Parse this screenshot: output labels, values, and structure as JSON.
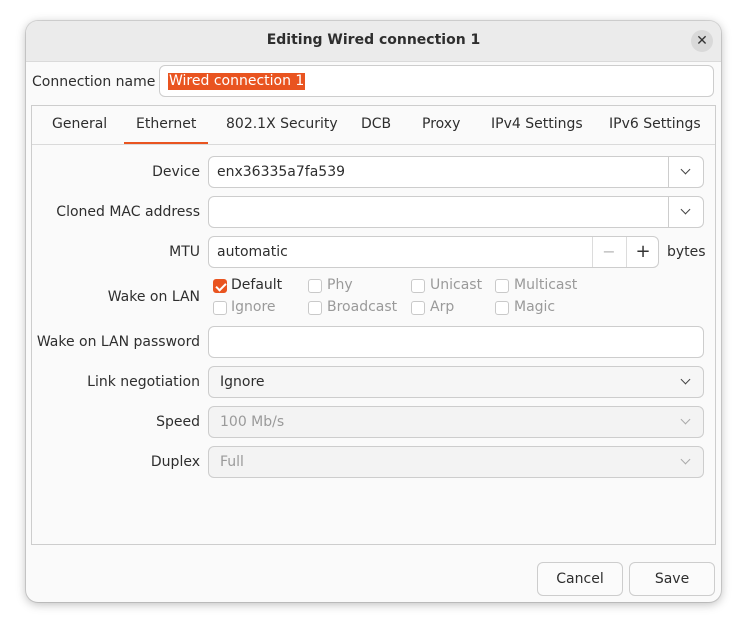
{
  "window": {
    "title": "Editing Wired connection 1"
  },
  "connection": {
    "label": "Connection name",
    "value": "Wired connection 1"
  },
  "tabs": [
    {
      "label": "General"
    },
    {
      "label": "Ethernet"
    },
    {
      "label": "802.1X Security"
    },
    {
      "label": "DCB"
    },
    {
      "label": "Proxy"
    },
    {
      "label": "IPv4 Settings"
    },
    {
      "label": "IPv6 Settings"
    }
  ],
  "active_tab": "Ethernet",
  "ethernet": {
    "device": {
      "label": "Device",
      "value": "enx36335a7fa539"
    },
    "cloned_mac": {
      "label": "Cloned MAC address",
      "value": ""
    },
    "mtu": {
      "label": "MTU",
      "value": "automatic",
      "unit": "bytes"
    },
    "wake_on_lan": {
      "label": "Wake on LAN",
      "options": [
        {
          "label": "Default",
          "checked": true
        },
        {
          "label": "Phy",
          "checked": false
        },
        {
          "label": "Unicast",
          "checked": false
        },
        {
          "label": "Multicast",
          "checked": false
        },
        {
          "label": "Ignore",
          "checked": false
        },
        {
          "label": "Broadcast",
          "checked": false
        },
        {
          "label": "Arp",
          "checked": false
        },
        {
          "label": "Magic",
          "checked": false
        }
      ]
    },
    "wol_password": {
      "label": "Wake on LAN password",
      "value": ""
    },
    "link_negotiation": {
      "label": "Link negotiation",
      "value": "Ignore"
    },
    "speed": {
      "label": "Speed",
      "value": "100 Mb/s"
    },
    "duplex": {
      "label": "Duplex",
      "value": "Full"
    }
  },
  "buttons": {
    "cancel": "Cancel",
    "save": "Save"
  },
  "colors": {
    "accent": "#e95420"
  }
}
